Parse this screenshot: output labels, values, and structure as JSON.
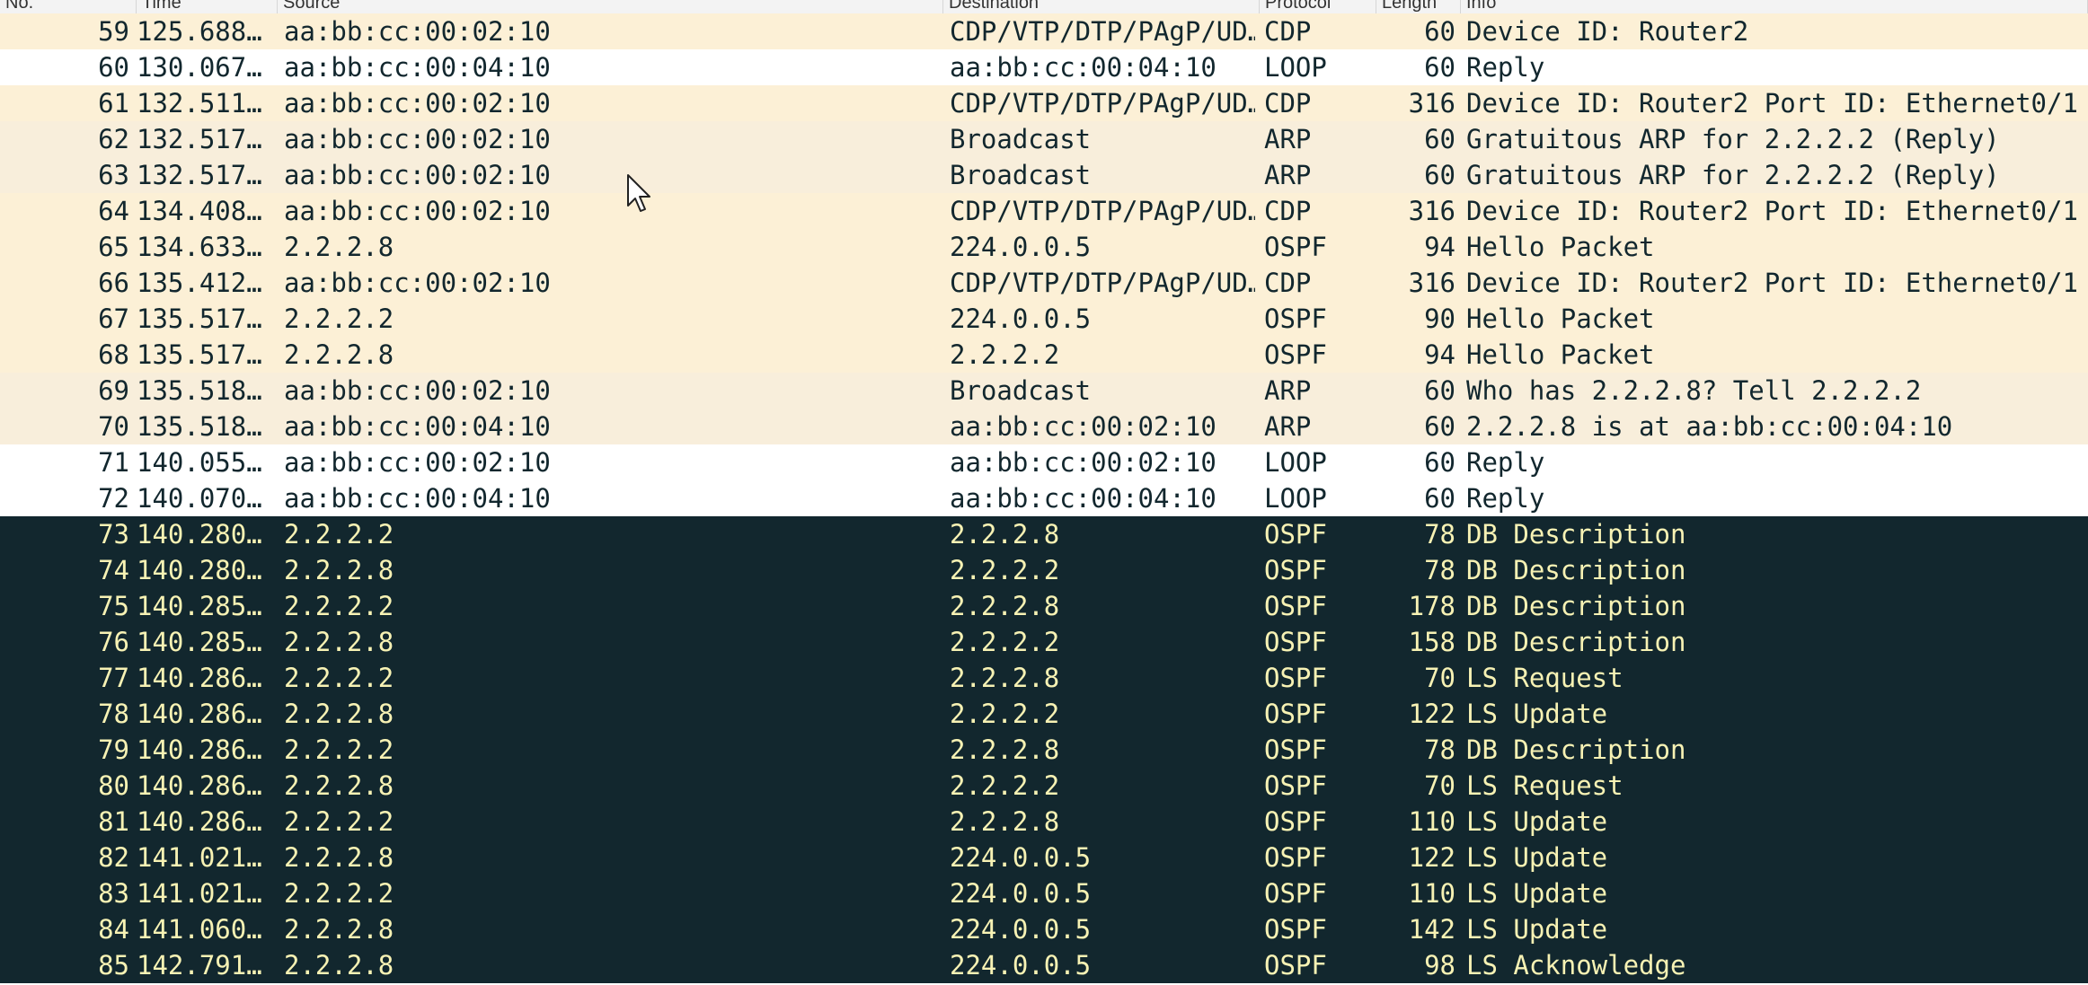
{
  "colors": {
    "cdp_arp_ospf_bg": "#fcf0d5",
    "arp_bg": "#faf0d7",
    "loop_bg": "#ffffff",
    "selected_bg": "#12272e",
    "selected_text": "#f7f2b4",
    "normal_text": "#12272e"
  },
  "columns": [
    "No.",
    "Time",
    "Source",
    "Destination",
    "Protocol",
    "Length",
    "Info"
  ],
  "packets": [
    {
      "no": "59",
      "time": "125.688…",
      "source": "aa:bb:cc:00:02:10",
      "destination": "CDP/VTP/DTP/PAgP/UD…",
      "protocol": "CDP",
      "length": "60",
      "info": "Device ID: Router2",
      "bg": "#fcf0d6",
      "selected": false
    },
    {
      "no": "60",
      "time": "130.067…",
      "source": "aa:bb:cc:00:04:10",
      "destination": "aa:bb:cc:00:04:10",
      "protocol": "LOOP",
      "length": "60",
      "info": "Reply",
      "bg": "#ffffff",
      "selected": false
    },
    {
      "no": "61",
      "time": "132.511…",
      "source": "aa:bb:cc:00:02:10",
      "destination": "CDP/VTP/DTP/PAgP/UD…",
      "protocol": "CDP",
      "length": "316",
      "info": "Device ID: Router2  Port ID: Ethernet0/1",
      "bg": "#fcf0d6",
      "selected": false
    },
    {
      "no": "62",
      "time": "132.517…",
      "source": "aa:bb:cc:00:02:10",
      "destination": "Broadcast",
      "protocol": "ARP",
      "length": "60",
      "info": "Gratuitous ARP for 2.2.2.2 (Reply)",
      "bg": "#f8eedb",
      "selected": false
    },
    {
      "no": "63",
      "time": "132.517…",
      "source": "aa:bb:cc:00:02:10",
      "destination": "Broadcast",
      "protocol": "ARP",
      "length": "60",
      "info": "Gratuitous ARP for 2.2.2.2 (Reply)",
      "bg": "#f8eedb",
      "selected": false
    },
    {
      "no": "64",
      "time": "134.408…",
      "source": "aa:bb:cc:00:02:10",
      "destination": "CDP/VTP/DTP/PAgP/UD…",
      "protocol": "CDP",
      "length": "316",
      "info": "Device ID: Router2  Port ID: Ethernet0/1",
      "bg": "#fcf0d6",
      "selected": false
    },
    {
      "no": "65",
      "time": "134.633…",
      "source": "2.2.2.8",
      "destination": "224.0.0.5",
      "protocol": "OSPF",
      "length": "94",
      "info": "Hello Packet",
      "bg": "#fcf0d6",
      "selected": false
    },
    {
      "no": "66",
      "time": "135.412…",
      "source": "aa:bb:cc:00:02:10",
      "destination": "CDP/VTP/DTP/PAgP/UD…",
      "protocol": "CDP",
      "length": "316",
      "info": "Device ID: Router2  Port ID: Ethernet0/1",
      "bg": "#fcf0d6",
      "selected": false
    },
    {
      "no": "67",
      "time": "135.517…",
      "source": "2.2.2.2",
      "destination": "224.0.0.5",
      "protocol": "OSPF",
      "length": "90",
      "info": "Hello Packet",
      "bg": "#fcf0d6",
      "selected": false
    },
    {
      "no": "68",
      "time": "135.517…",
      "source": "2.2.2.8",
      "destination": "2.2.2.2",
      "protocol": "OSPF",
      "length": "94",
      "info": "Hello Packet",
      "bg": "#fcf0d6",
      "selected": false
    },
    {
      "no": "69",
      "time": "135.518…",
      "source": "aa:bb:cc:00:02:10",
      "destination": "Broadcast",
      "protocol": "ARP",
      "length": "60",
      "info": "Who has 2.2.2.8? Tell 2.2.2.2",
      "bg": "#f8eedb",
      "selected": false
    },
    {
      "no": "70",
      "time": "135.518…",
      "source": "aa:bb:cc:00:04:10",
      "destination": "aa:bb:cc:00:02:10",
      "protocol": "ARP",
      "length": "60",
      "info": "2.2.2.8 is at aa:bb:cc:00:04:10",
      "bg": "#f8eedb",
      "selected": false
    },
    {
      "no": "71",
      "time": "140.055…",
      "source": "aa:bb:cc:00:02:10",
      "destination": "aa:bb:cc:00:02:10",
      "protocol": "LOOP",
      "length": "60",
      "info": "Reply",
      "bg": "#ffffff",
      "selected": false
    },
    {
      "no": "72",
      "time": "140.070…",
      "source": "aa:bb:cc:00:04:10",
      "destination": "aa:bb:cc:00:04:10",
      "protocol": "LOOP",
      "length": "60",
      "info": "Reply",
      "bg": "#ffffff",
      "selected": false
    },
    {
      "no": "73",
      "time": "140.280…",
      "source": "2.2.2.2",
      "destination": "2.2.2.8",
      "protocol": "OSPF",
      "length": "78",
      "info": "DB Description",
      "bg": "#12272e",
      "selected": true
    },
    {
      "no": "74",
      "time": "140.280…",
      "source": "2.2.2.8",
      "destination": "2.2.2.2",
      "protocol": "OSPF",
      "length": "78",
      "info": "DB Description",
      "bg": "#12272e",
      "selected": true
    },
    {
      "no": "75",
      "time": "140.285…",
      "source": "2.2.2.2",
      "destination": "2.2.2.8",
      "protocol": "OSPF",
      "length": "178",
      "info": "DB Description",
      "bg": "#12272e",
      "selected": true
    },
    {
      "no": "76",
      "time": "140.285…",
      "source": "2.2.2.8",
      "destination": "2.2.2.2",
      "protocol": "OSPF",
      "length": "158",
      "info": "DB Description",
      "bg": "#12272e",
      "selected": true
    },
    {
      "no": "77",
      "time": "140.286…",
      "source": "2.2.2.2",
      "destination": "2.2.2.8",
      "protocol": "OSPF",
      "length": "70",
      "info": "LS Request",
      "bg": "#12272e",
      "selected": true
    },
    {
      "no": "78",
      "time": "140.286…",
      "source": "2.2.2.8",
      "destination": "2.2.2.2",
      "protocol": "OSPF",
      "length": "122",
      "info": "LS Update",
      "bg": "#12272e",
      "selected": true
    },
    {
      "no": "79",
      "time": "140.286…",
      "source": "2.2.2.2",
      "destination": "2.2.2.8",
      "protocol": "OSPF",
      "length": "78",
      "info": "DB Description",
      "bg": "#12272e",
      "selected": true
    },
    {
      "no": "80",
      "time": "140.286…",
      "source": "2.2.2.8",
      "destination": "2.2.2.2",
      "protocol": "OSPF",
      "length": "70",
      "info": "LS Request",
      "bg": "#12272e",
      "selected": true
    },
    {
      "no": "81",
      "time": "140.286…",
      "source": "2.2.2.2",
      "destination": "2.2.2.8",
      "protocol": "OSPF",
      "length": "110",
      "info": "LS Update",
      "bg": "#12272e",
      "selected": true
    },
    {
      "no": "82",
      "time": "141.021…",
      "source": "2.2.2.8",
      "destination": "224.0.0.5",
      "protocol": "OSPF",
      "length": "122",
      "info": "LS Update",
      "bg": "#12272e",
      "selected": true
    },
    {
      "no": "83",
      "time": "141.021…",
      "source": "2.2.2.2",
      "destination": "224.0.0.5",
      "protocol": "OSPF",
      "length": "110",
      "info": "LS Update",
      "bg": "#12272e",
      "selected": true
    },
    {
      "no": "84",
      "time": "141.060…",
      "source": "2.2.2.8",
      "destination": "224.0.0.5",
      "protocol": "OSPF",
      "length": "142",
      "info": "LS Update",
      "bg": "#12272e",
      "selected": true
    },
    {
      "no": "85",
      "time": "142.791…",
      "source": "2.2.2.8",
      "destination": "224.0.0.5",
      "protocol": "OSPF",
      "length": "98",
      "info": "LS Acknowledge",
      "bg": "#12272e",
      "selected": true
    }
  ]
}
